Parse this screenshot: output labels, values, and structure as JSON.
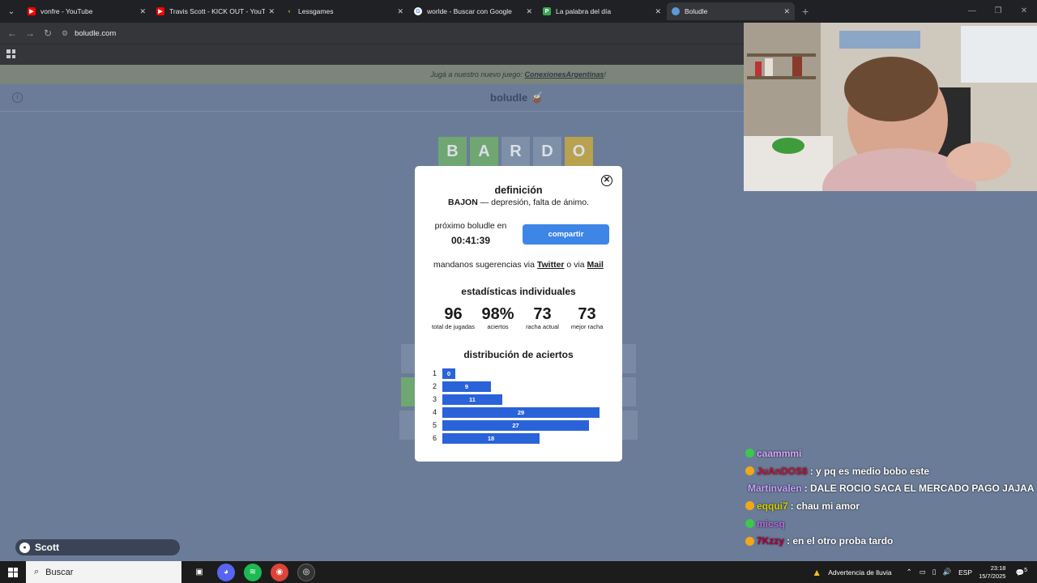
{
  "browser": {
    "tabs": [
      {
        "title": "vonfre - YouTube",
        "favicon": "youtube-icon",
        "color": "#ff0000"
      },
      {
        "title": "Travis Scott - KICK OUT - YouTu",
        "favicon": "youtube-icon",
        "color": "#ff0000"
      },
      {
        "title": "Lessgames",
        "favicon": "lessgames-icon",
        "color": "#2b2b2b"
      },
      {
        "title": "worlde - Buscar con Google",
        "favicon": "google-icon",
        "color": "#ffffff"
      },
      {
        "title": "La palabra del día",
        "favicon": "palabra-icon",
        "color": "#3aa655"
      },
      {
        "title": "Boludle",
        "favicon": "boludle-icon",
        "color": "#5c9bd6"
      }
    ],
    "url": "boludle.com"
  },
  "site": {
    "banner_text": "Jugá a nuestro nuevo juego: ",
    "banner_link": "ConexionesArgentinas",
    "banner_end": "!",
    "logo": "boludle 🧉",
    "tiles": [
      "B",
      "A",
      "R",
      "D",
      "O"
    ],
    "tile_colors": [
      "#6fa672",
      "#6fa672",
      "#7e8fa8",
      "#7e8fa8",
      "#b8a14f"
    ]
  },
  "modal": {
    "definition_title": "definición",
    "word": "BAJON",
    "definition": " — depresión, falta de ánimo.",
    "next_label": "próximo boludle en",
    "timer": "00:41:39",
    "share_label": "compartir",
    "suggest_text": "mandanos sugerencias via ",
    "twitter": "Twitter",
    "or_via": " o via ",
    "mail": "Mail",
    "stats_title": "estadísticas individuales",
    "stats": [
      {
        "value": "96",
        "label": "total de jugadas"
      },
      {
        "value": "98%",
        "label": "aciertos"
      },
      {
        "value": "73",
        "label": "racha actual"
      },
      {
        "value": "73",
        "label": "mejor racha"
      }
    ],
    "dist_title": "distribución de aciertos",
    "distribution": [
      {
        "guess": "1",
        "count": 0
      },
      {
        "guess": "2",
        "count": 9
      },
      {
        "guess": "3",
        "count": 11
      },
      {
        "guess": "4",
        "count": 29
      },
      {
        "guess": "5",
        "count": 27
      },
      {
        "guess": "6",
        "count": 18
      }
    ]
  },
  "chat": [
    {
      "user": "caammmi",
      "text": "",
      "color": "#d9a6ff"
    },
    {
      "user": "JuAnDOS8",
      "text": ": y pq es medio bobo este",
      "color": "#c0143c"
    },
    {
      "user": "Martinvalen",
      "text": ": DALE ROCIO SACA EL MERCADO PAGO JAJAA",
      "color": "#c8a0ff"
    },
    {
      "user": "eqqui7",
      "text": ": chau mi amor",
      "color": "#d7d000"
    },
    {
      "user": "micsq",
      "text": "",
      "color": "#b46be0"
    },
    {
      "user": "7Kzzy",
      "text": ": en el otro proba tardo",
      "color": "#b00040"
    }
  ],
  "overlay_name": "Scott",
  "taskbar": {
    "search_label": "Buscar",
    "weather": "Advertencia de lluvia",
    "lang": "ESP",
    "time": "23:18",
    "date": "15/7/2025",
    "notif": "5"
  }
}
